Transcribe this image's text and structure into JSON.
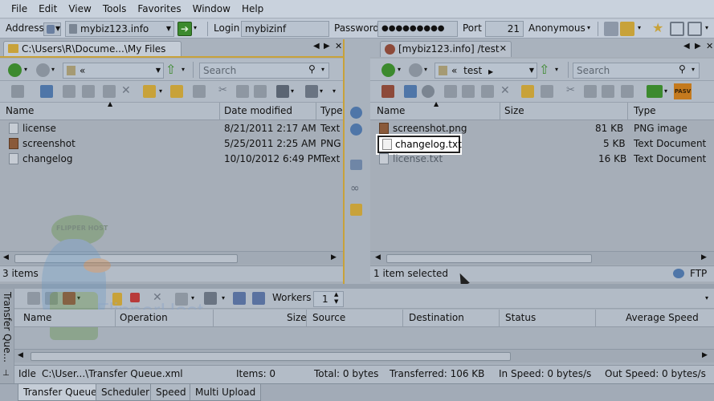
{
  "menu": [
    "File",
    "Edit",
    "View",
    "Tools",
    "Favorites",
    "Window",
    "Help"
  ],
  "address_bar": {
    "address_label": "Address",
    "address_value": "mybiz123.info",
    "login_label": "Login",
    "login_value": "mybizinf",
    "password_label": "Password",
    "password_value": "●●●●●●●●●",
    "port_label": "Port",
    "port_value": "21",
    "anonymous_label": "Anonymous"
  },
  "left_panel": {
    "tab_label": "C:\\Users\\R\\Docume...\\My Files",
    "path_crumb": "«",
    "search_placeholder": "Search",
    "columns": [
      "Name",
      "Date modified",
      "Type"
    ],
    "files": [
      {
        "name": "license",
        "date": "8/21/2011 2:17 AM",
        "type": "Text"
      },
      {
        "name": "screenshot",
        "date": "5/25/2011 2:25 AM",
        "type": "PNG"
      },
      {
        "name": "changelog",
        "date": "10/10/2012 6:49 PM",
        "type": "Text"
      }
    ],
    "status": "3 items"
  },
  "right_panel": {
    "tab_label": "[mybiz123.info] /test",
    "path_crumb": "«",
    "path_folder": "test",
    "search_placeholder": "Search",
    "pasv_label": "PASV",
    "columns": [
      "Name",
      "Size",
      "Type"
    ],
    "files": [
      {
        "name": "screenshot.png",
        "size": "81 KB",
        "type": "PNG image"
      },
      {
        "name": "changelog.txt",
        "size": "5 KB",
        "type": "Text Document"
      },
      {
        "name": "license.txt",
        "size": "16 KB",
        "type": "Text Document"
      }
    ],
    "status": "1 item selected",
    "protocol": "FTP"
  },
  "queue": {
    "sidebar_title": "Transfer Que...",
    "workers_label": "Workers",
    "workers_value": "1",
    "columns": [
      "Name",
      "Operation",
      "Size",
      "Source",
      "Destination",
      "Status",
      "Average Speed"
    ],
    "status": {
      "state": "Idle",
      "file": "C:\\User...\\Transfer Queue.xml",
      "items": "Items: 0",
      "total": "Total: 0 bytes",
      "transferred": "Transferred: 106 KB",
      "in_speed": "In Speed: 0 bytes/s",
      "out_speed": "Out Speed: 0 bytes/s"
    },
    "watermark": "FlipperHost",
    "logo_text": "FLIPPER HOST"
  },
  "bottom_tabs": [
    "Transfer Queue",
    "Scheduler",
    "Speed",
    "Multi Upload"
  ],
  "colors": {
    "accent_yellow": "#c8a23a",
    "go_green": "#3c8a2e",
    "pasv_orange": "#c47a1e"
  }
}
